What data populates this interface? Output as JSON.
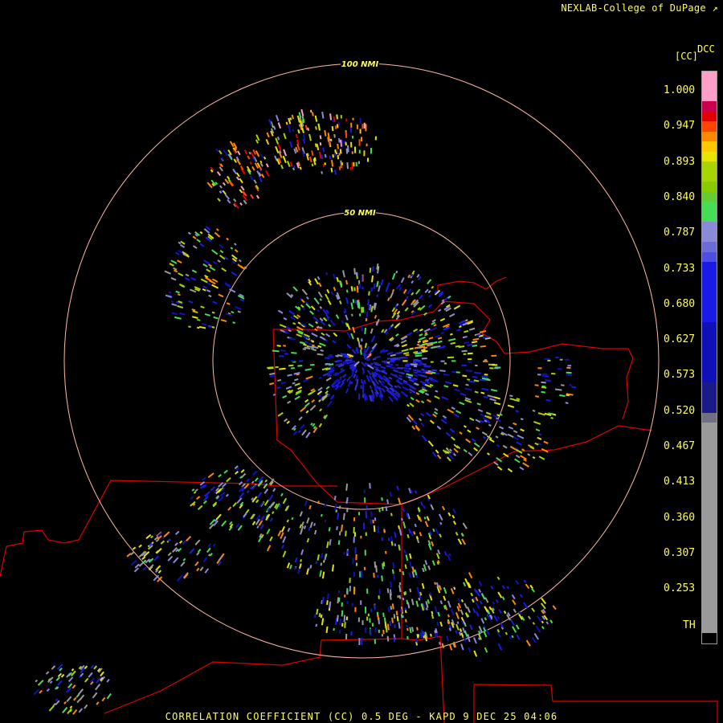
{
  "header": {
    "credit": "NEXLAB-College of DuPage"
  },
  "legend": {
    "product": "DCC",
    "unit": "[CC]",
    "ticks": [
      "1.000",
      "0.947",
      "0.893",
      "0.840",
      "0.787",
      "0.733",
      "0.680",
      "0.627",
      "0.573",
      "0.520",
      "0.467",
      "0.413",
      "0.360",
      "0.307",
      "0.253",
      "TH"
    ],
    "swatches": [
      {
        "color": "#ff9ec9",
        "weight": 3
      },
      {
        "color": "#c8004e",
        "weight": 1
      },
      {
        "color": "#e00000",
        "weight": 1
      },
      {
        "color": "#ff4400",
        "weight": 1
      },
      {
        "color": "#ff8800",
        "weight": 1
      },
      {
        "color": "#ffc800",
        "weight": 1
      },
      {
        "color": "#e6e600",
        "weight": 1
      },
      {
        "color": "#a8d400",
        "weight": 2
      },
      {
        "color": "#88cc00",
        "weight": 1
      },
      {
        "color": "#66cc33",
        "weight": 1
      },
      {
        "color": "#44dd55",
        "weight": 2
      },
      {
        "color": "#8a8ad8",
        "weight": 2
      },
      {
        "color": "#6c6cd8",
        "weight": 1
      },
      {
        "color": "#4e4ee0",
        "weight": 1
      },
      {
        "color": "#1a1ae6",
        "weight": 6
      },
      {
        "color": "#1010b8",
        "weight": 6
      },
      {
        "color": "#1a1a8a",
        "weight": 3
      },
      {
        "color": "#707080",
        "weight": 1
      },
      {
        "color": "#9a9a9a",
        "weight": 21
      },
      {
        "color": "#000000",
        "weight": 1
      }
    ]
  },
  "map": {
    "range_rings": [
      {
        "label": "100 NMI",
        "radius_nmi": 100
      },
      {
        "label": "50 NMI",
        "radius_nmi": 50
      }
    ],
    "ring_color": "#ffb8a8",
    "border_color": "#e00000",
    "label_color": "#ffff55"
  },
  "caption": "CORRELATION COEFFICIENT (CC) 0.5 DEG - KAPD 9 DEC 25 04:06"
}
